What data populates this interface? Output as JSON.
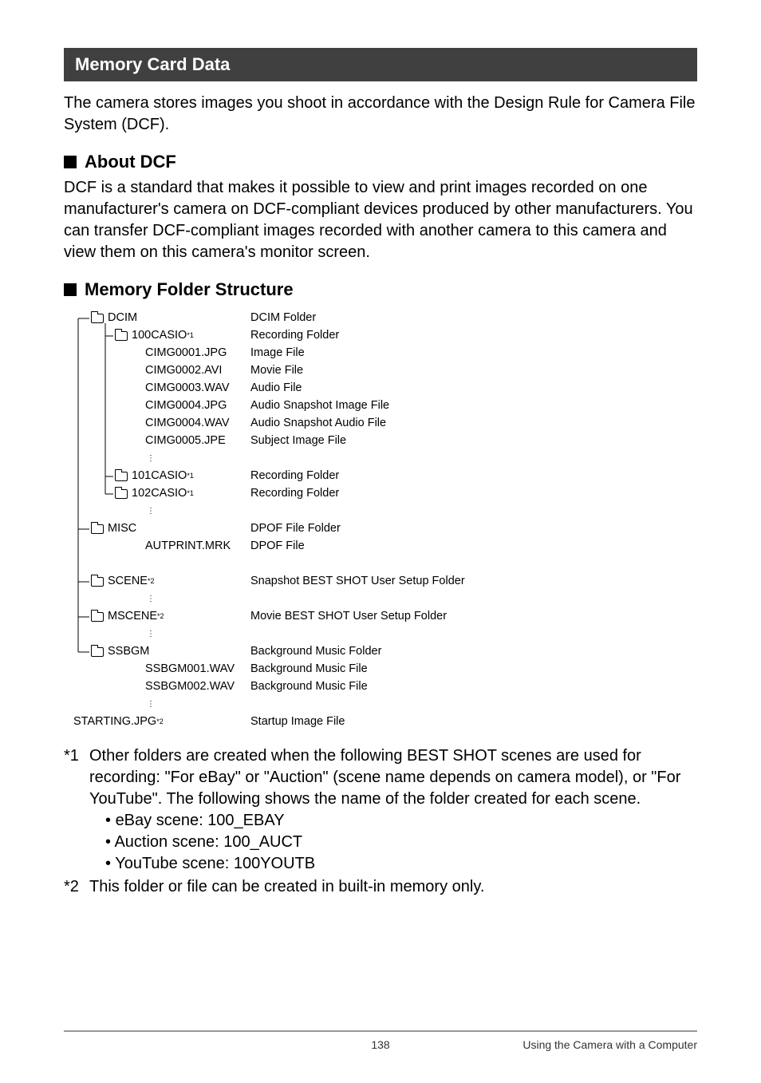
{
  "section": {
    "title": "Memory Card Data",
    "intro": "The camera stores images you shoot in accordance with the Design Rule for Camera File System (DCF)."
  },
  "about_dcf": {
    "heading": "About DCF",
    "text": "DCF is a standard that makes it possible to view and print images recorded on one manufacturer's camera on DCF-compliant devices produced by other manufacturers. You can transfer DCF-compliant images recorded with another camera to this camera and view them on this camera's monitor screen."
  },
  "folder_structure": {
    "heading": "Memory Folder Structure",
    "items": [
      {
        "name": "DCIM",
        "desc": "DCIM Folder",
        "folder": true,
        "indent": 1
      },
      {
        "name": "100CASIO ",
        "sup": "*1",
        "desc": "Recording Folder",
        "folder": true,
        "indent": 2
      },
      {
        "name": "CIMG0001.JPG",
        "desc": "Image File",
        "indent": 3
      },
      {
        "name": "CIMG0002.AVI",
        "desc": "Movie File",
        "indent": 3
      },
      {
        "name": "CIMG0003.WAV",
        "desc": "Audio File",
        "indent": 3
      },
      {
        "name": "CIMG0004.JPG",
        "desc": "Audio Snapshot Image File",
        "indent": 3
      },
      {
        "name": "CIMG0004.WAV",
        "desc": "Audio Snapshot Audio File",
        "indent": 3
      },
      {
        "name": "CIMG0005.JPE",
        "desc": "Subject Image File",
        "indent": 3
      },
      {
        "vdots": true,
        "indent": 3
      },
      {
        "name": "101CASIO ",
        "sup": "*1",
        "desc": "Recording Folder",
        "folder": true,
        "indent": 2
      },
      {
        "name": "102CASIO ",
        "sup": "*1",
        "desc": "Recording Folder",
        "folder": true,
        "indent": 2
      },
      {
        "vdots": true,
        "indent": 3
      },
      {
        "name": "MISC",
        "desc": "DPOF File Folder",
        "folder": true,
        "indent": 1
      },
      {
        "name": "AUTPRINT.MRK",
        "desc": "DPOF File",
        "indent": 3
      },
      {
        "spacer": true
      },
      {
        "name": "SCENE ",
        "sup": "*2",
        "desc": "Snapshot BEST SHOT User Setup Folder",
        "folder": true,
        "indent": 1
      },
      {
        "vdots": true,
        "indent": 3
      },
      {
        "name": "MSCENE ",
        "sup": "*2",
        "desc": "Movie BEST SHOT User Setup Folder",
        "folder": true,
        "indent": 1
      },
      {
        "vdots": true,
        "indent": 3
      },
      {
        "name": "SSBGM",
        "desc": "Background Music Folder",
        "folder": true,
        "indent": 1
      },
      {
        "name": "SSBGM001.WAV",
        "desc": "Background Music File",
        "indent": 3
      },
      {
        "name": "SSBGM002.WAV",
        "desc": "Background Music File",
        "indent": 3
      },
      {
        "vdots": true,
        "indent": 3
      },
      {
        "name": "STARTING.JPG ",
        "sup": "*2",
        "desc": "Startup Image File",
        "indent": 0
      }
    ]
  },
  "notes": {
    "n1_marker": "*1",
    "n1_text": "Other folders are created when the following BEST SHOT scenes are used for recording: \"For eBay\" or \"Auction\" (scene name depends on camera model), or \"For YouTube\". The following shows the name of the folder created for each scene.",
    "n1_bullets": [
      "eBay scene: 100_EBAY",
      "Auction scene: 100_AUCT",
      "YouTube scene: 100YOUTB"
    ],
    "n2_marker": "*2",
    "n2_text": "This folder or file can be created in built-in memory only."
  },
  "footer": {
    "page": "138",
    "title": "Using the Camera with a Computer"
  }
}
